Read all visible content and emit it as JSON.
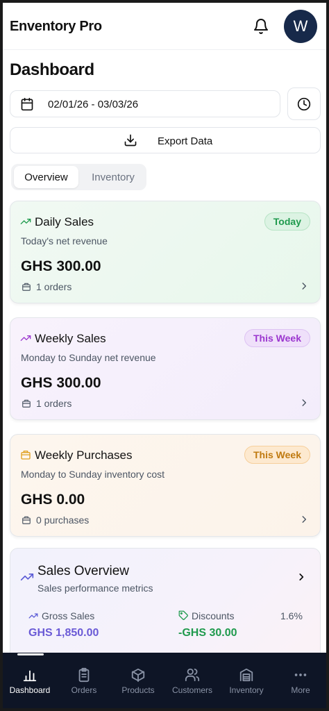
{
  "header": {
    "app_title": "Enventory Pro",
    "avatar_initial": "W"
  },
  "page": {
    "title": "Dashboard"
  },
  "filters": {
    "date_range": "02/01/26 - 03/03/26",
    "export_label": "Export Data"
  },
  "tabs": [
    {
      "label": "Overview",
      "active": true
    },
    {
      "label": "Inventory",
      "active": false
    }
  ],
  "cards": [
    {
      "title": "Daily Sales",
      "badge": "Today",
      "subtitle": "Today's net revenue",
      "amount": "GHS 300.00",
      "count": "1 orders"
    },
    {
      "title": "Weekly Sales",
      "badge": "This Week",
      "subtitle": "Monday to Sunday net revenue",
      "amount": "GHS 300.00",
      "count": "1 orders"
    },
    {
      "title": "Weekly Purchases",
      "badge": "This Week",
      "subtitle": "Monday to Sunday inventory cost",
      "amount": "GHS 0.00",
      "count": "0 purchases"
    }
  ],
  "overview": {
    "title": "Sales Overview",
    "subtitle": "Sales performance metrics",
    "gross_label": "Gross Sales",
    "gross_value": "GHS 1,850.00",
    "discounts_label": "Discounts",
    "discounts_value": "-GHS 30.00",
    "discounts_pct": "1.6%"
  },
  "colors": {
    "accent_navy": "#17294a",
    "green": "#1f9a4d",
    "purple": "#9b36cf",
    "orange": "#c07a10",
    "indigo": "#5b5bd6"
  },
  "nav": [
    {
      "label": "Dashboard",
      "icon": "bar-chart-icon",
      "active": true
    },
    {
      "label": "Orders",
      "icon": "clipboard-icon",
      "active": false
    },
    {
      "label": "Products",
      "icon": "box-icon",
      "active": false
    },
    {
      "label": "Customers",
      "icon": "users-icon",
      "active": false
    },
    {
      "label": "Inventory",
      "icon": "warehouse-icon",
      "active": false
    },
    {
      "label": "More",
      "icon": "more-icon",
      "active": false
    }
  ]
}
